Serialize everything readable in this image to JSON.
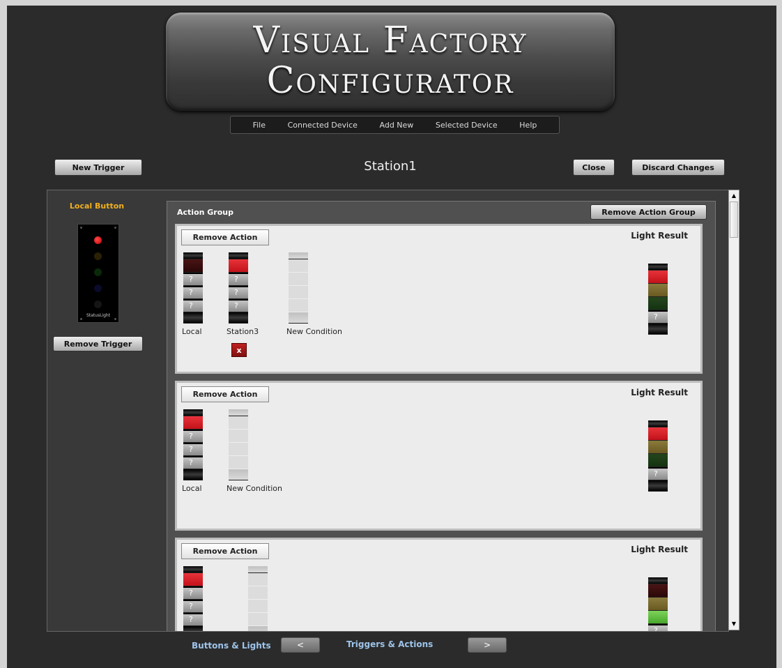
{
  "banner": {
    "line1": "Visual Factory",
    "line2": "Configurator"
  },
  "menu": [
    "File",
    "Connected Device",
    "Add New",
    "Selected Device",
    "Help"
  ],
  "header": {
    "new_trigger_label": "New Trigger",
    "title": "Station1",
    "close_label": "Close",
    "discard_label": "Discard Changes"
  },
  "left": {
    "title": "Local Button",
    "device_logo": "StatusLight",
    "remove_trigger_label": "Remove Trigger"
  },
  "action_group": {
    "title": "Action Group",
    "remove_group_label": "Remove Action Group",
    "remove_action_label": "Remove Action",
    "light_result_label": "Light Result",
    "question_mark": "?",
    "delete_glyph": "x",
    "actions": [
      {
        "conditions": [
          {
            "label": "Local",
            "lights": [
              "darkred",
              "unknown",
              "unknown",
              "unknown"
            ]
          },
          {
            "label": "Station3",
            "lights": [
              "red",
              "unknown",
              "unknown",
              "unknown"
            ],
            "deletable": true
          },
          {
            "label": "New Condition",
            "lights": [
              "empty",
              "empty",
              "empty",
              "empty"
            ]
          }
        ],
        "result": [
          "red",
          "olive",
          "darkgreen",
          "unknown"
        ]
      },
      {
        "conditions": [
          {
            "label": "Local",
            "lights": [
              "red",
              "unknown",
              "unknown",
              "unknown"
            ]
          },
          {
            "label": "New Condition",
            "lights": [
              "empty",
              "empty",
              "empty",
              "empty"
            ]
          }
        ],
        "result": [
          "red",
          "olive",
          "darkgreen",
          "unknown"
        ]
      },
      {
        "conditions": [
          {
            "label": "",
            "lights": [
              "red",
              "unknown",
              "unknown",
              "unknown"
            ]
          },
          {
            "label": "",
            "lights": [
              "empty",
              "empty",
              "empty",
              "empty"
            ]
          }
        ],
        "result": [
          "darkred",
          "olive",
          "lightgreen",
          "unknown"
        ]
      }
    ]
  },
  "footer": {
    "nav_left_label": "Buttons & Lights",
    "prev_glyph": "<",
    "nav_right_label": "Triggers & Actions",
    "next_glyph": ">"
  },
  "scrollbar": {
    "up_glyph": "▲",
    "down_glyph": "▼"
  },
  "colors": {
    "background": "#2b2b2b",
    "accent_orange": "#f0b020",
    "nav_blue": "#9ec4ea",
    "light_red": "#e6333a",
    "light_olive": "#8a7a3c",
    "light_darkgreen": "#24461c",
    "light_lightgreen": "#7ed35a"
  }
}
